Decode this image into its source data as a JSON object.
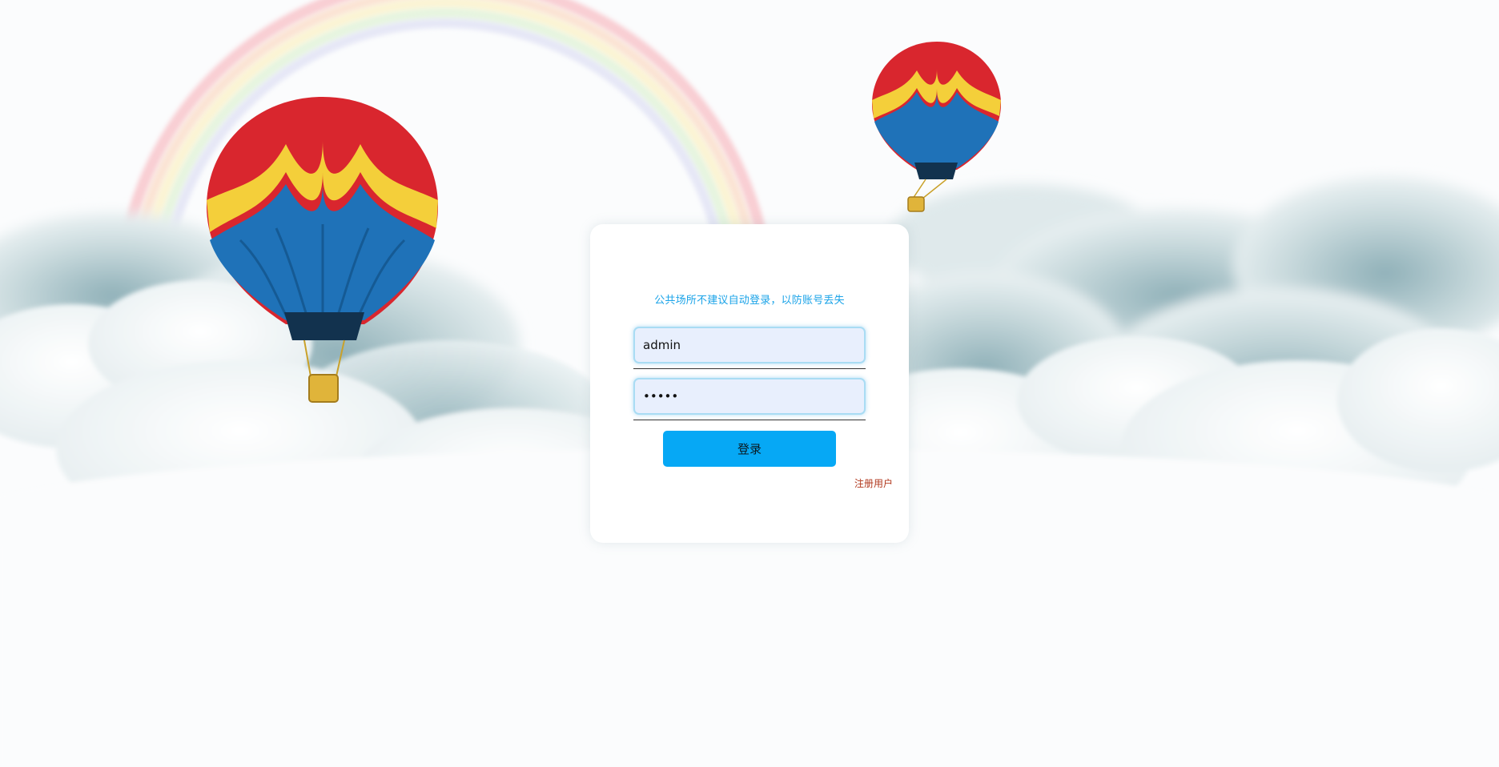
{
  "login": {
    "notice": "公共场所不建议自动登录，以防账号丢失",
    "username_value": "admin",
    "password_value": "•••••",
    "submit_label": "登录",
    "register_label": "注册用户"
  },
  "colors": {
    "accent": "#06a8f5",
    "notice_text": "#1aa3e8",
    "register_link": "#b0361b",
    "input_bg": "#e8effd"
  }
}
